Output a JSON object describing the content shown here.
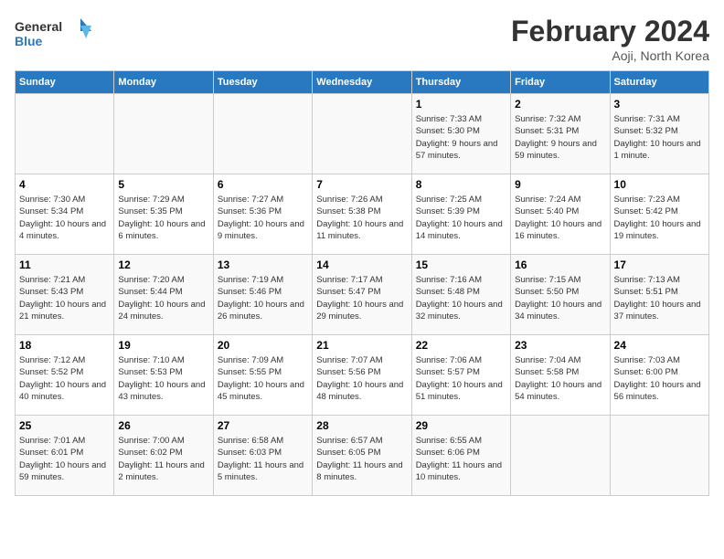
{
  "header": {
    "logo_general": "General",
    "logo_blue": "Blue",
    "title": "February 2024",
    "subtitle": "Aoji, North Korea"
  },
  "weekdays": [
    "Sunday",
    "Monday",
    "Tuesday",
    "Wednesday",
    "Thursday",
    "Friday",
    "Saturday"
  ],
  "weeks": [
    [
      {
        "day": "",
        "sunrise": "",
        "sunset": "",
        "daylight": ""
      },
      {
        "day": "",
        "sunrise": "",
        "sunset": "",
        "daylight": ""
      },
      {
        "day": "",
        "sunrise": "",
        "sunset": "",
        "daylight": ""
      },
      {
        "day": "",
        "sunrise": "",
        "sunset": "",
        "daylight": ""
      },
      {
        "day": "1",
        "sunrise": "Sunrise: 7:33 AM",
        "sunset": "Sunset: 5:30 PM",
        "daylight": "Daylight: 9 hours and 57 minutes."
      },
      {
        "day": "2",
        "sunrise": "Sunrise: 7:32 AM",
        "sunset": "Sunset: 5:31 PM",
        "daylight": "Daylight: 9 hours and 59 minutes."
      },
      {
        "day": "3",
        "sunrise": "Sunrise: 7:31 AM",
        "sunset": "Sunset: 5:32 PM",
        "daylight": "Daylight: 10 hours and 1 minute."
      }
    ],
    [
      {
        "day": "4",
        "sunrise": "Sunrise: 7:30 AM",
        "sunset": "Sunset: 5:34 PM",
        "daylight": "Daylight: 10 hours and 4 minutes."
      },
      {
        "day": "5",
        "sunrise": "Sunrise: 7:29 AM",
        "sunset": "Sunset: 5:35 PM",
        "daylight": "Daylight: 10 hours and 6 minutes."
      },
      {
        "day": "6",
        "sunrise": "Sunrise: 7:27 AM",
        "sunset": "Sunset: 5:36 PM",
        "daylight": "Daylight: 10 hours and 9 minutes."
      },
      {
        "day": "7",
        "sunrise": "Sunrise: 7:26 AM",
        "sunset": "Sunset: 5:38 PM",
        "daylight": "Daylight: 10 hours and 11 minutes."
      },
      {
        "day": "8",
        "sunrise": "Sunrise: 7:25 AM",
        "sunset": "Sunset: 5:39 PM",
        "daylight": "Daylight: 10 hours and 14 minutes."
      },
      {
        "day": "9",
        "sunrise": "Sunrise: 7:24 AM",
        "sunset": "Sunset: 5:40 PM",
        "daylight": "Daylight: 10 hours and 16 minutes."
      },
      {
        "day": "10",
        "sunrise": "Sunrise: 7:23 AM",
        "sunset": "Sunset: 5:42 PM",
        "daylight": "Daylight: 10 hours and 19 minutes."
      }
    ],
    [
      {
        "day": "11",
        "sunrise": "Sunrise: 7:21 AM",
        "sunset": "Sunset: 5:43 PM",
        "daylight": "Daylight: 10 hours and 21 minutes."
      },
      {
        "day": "12",
        "sunrise": "Sunrise: 7:20 AM",
        "sunset": "Sunset: 5:44 PM",
        "daylight": "Daylight: 10 hours and 24 minutes."
      },
      {
        "day": "13",
        "sunrise": "Sunrise: 7:19 AM",
        "sunset": "Sunset: 5:46 PM",
        "daylight": "Daylight: 10 hours and 26 minutes."
      },
      {
        "day": "14",
        "sunrise": "Sunrise: 7:17 AM",
        "sunset": "Sunset: 5:47 PM",
        "daylight": "Daylight: 10 hours and 29 minutes."
      },
      {
        "day": "15",
        "sunrise": "Sunrise: 7:16 AM",
        "sunset": "Sunset: 5:48 PM",
        "daylight": "Daylight: 10 hours and 32 minutes."
      },
      {
        "day": "16",
        "sunrise": "Sunrise: 7:15 AM",
        "sunset": "Sunset: 5:50 PM",
        "daylight": "Daylight: 10 hours and 34 minutes."
      },
      {
        "day": "17",
        "sunrise": "Sunrise: 7:13 AM",
        "sunset": "Sunset: 5:51 PM",
        "daylight": "Daylight: 10 hours and 37 minutes."
      }
    ],
    [
      {
        "day": "18",
        "sunrise": "Sunrise: 7:12 AM",
        "sunset": "Sunset: 5:52 PM",
        "daylight": "Daylight: 10 hours and 40 minutes."
      },
      {
        "day": "19",
        "sunrise": "Sunrise: 7:10 AM",
        "sunset": "Sunset: 5:53 PM",
        "daylight": "Daylight: 10 hours and 43 minutes."
      },
      {
        "day": "20",
        "sunrise": "Sunrise: 7:09 AM",
        "sunset": "Sunset: 5:55 PM",
        "daylight": "Daylight: 10 hours and 45 minutes."
      },
      {
        "day": "21",
        "sunrise": "Sunrise: 7:07 AM",
        "sunset": "Sunset: 5:56 PM",
        "daylight": "Daylight: 10 hours and 48 minutes."
      },
      {
        "day": "22",
        "sunrise": "Sunrise: 7:06 AM",
        "sunset": "Sunset: 5:57 PM",
        "daylight": "Daylight: 10 hours and 51 minutes."
      },
      {
        "day": "23",
        "sunrise": "Sunrise: 7:04 AM",
        "sunset": "Sunset: 5:58 PM",
        "daylight": "Daylight: 10 hours and 54 minutes."
      },
      {
        "day": "24",
        "sunrise": "Sunrise: 7:03 AM",
        "sunset": "Sunset: 6:00 PM",
        "daylight": "Daylight: 10 hours and 56 minutes."
      }
    ],
    [
      {
        "day": "25",
        "sunrise": "Sunrise: 7:01 AM",
        "sunset": "Sunset: 6:01 PM",
        "daylight": "Daylight: 10 hours and 59 minutes."
      },
      {
        "day": "26",
        "sunrise": "Sunrise: 7:00 AM",
        "sunset": "Sunset: 6:02 PM",
        "daylight": "Daylight: 11 hours and 2 minutes."
      },
      {
        "day": "27",
        "sunrise": "Sunrise: 6:58 AM",
        "sunset": "Sunset: 6:03 PM",
        "daylight": "Daylight: 11 hours and 5 minutes."
      },
      {
        "day": "28",
        "sunrise": "Sunrise: 6:57 AM",
        "sunset": "Sunset: 6:05 PM",
        "daylight": "Daylight: 11 hours and 8 minutes."
      },
      {
        "day": "29",
        "sunrise": "Sunrise: 6:55 AM",
        "sunset": "Sunset: 6:06 PM",
        "daylight": "Daylight: 11 hours and 10 minutes."
      },
      {
        "day": "",
        "sunrise": "",
        "sunset": "",
        "daylight": ""
      },
      {
        "day": "",
        "sunrise": "",
        "sunset": "",
        "daylight": ""
      }
    ]
  ]
}
